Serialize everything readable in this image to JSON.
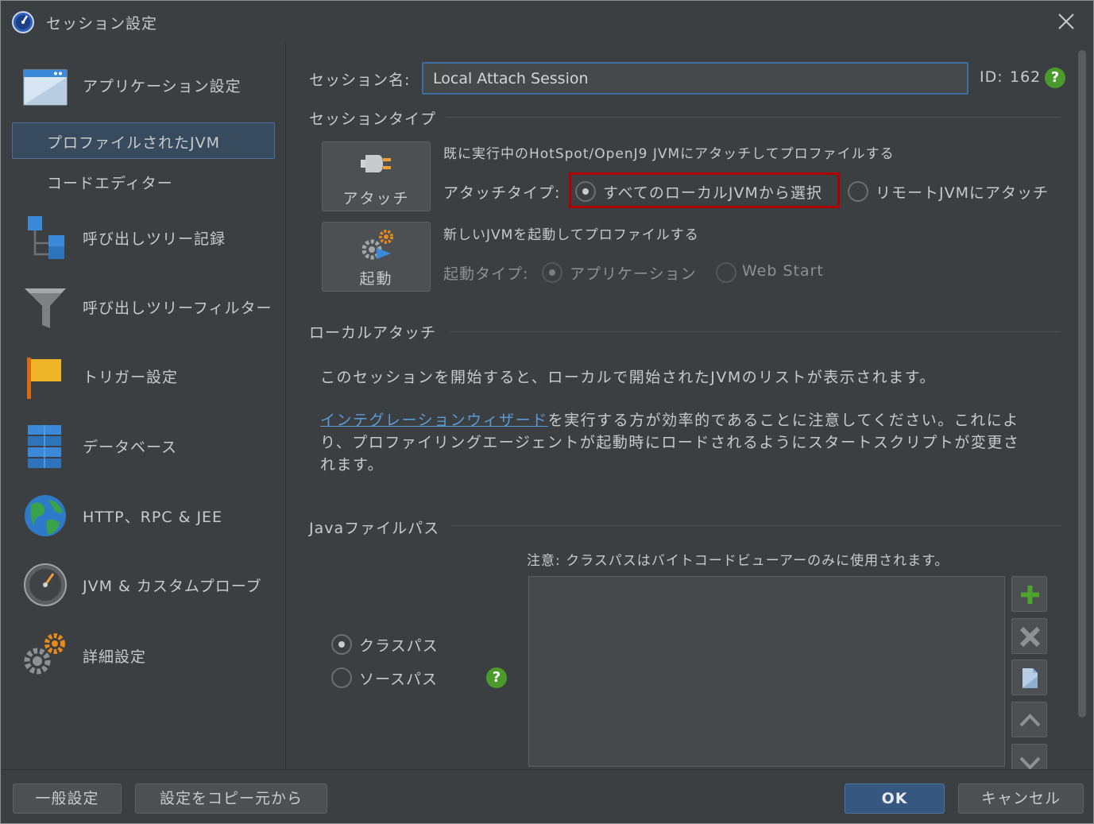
{
  "window": {
    "title": "セッション設定"
  },
  "sidebar": {
    "items": [
      {
        "label": "アプリケーション設定",
        "icon": "application-window-icon"
      },
      {
        "label": "プロファイルされたJVM",
        "selected": true
      },
      {
        "label": "コードエディター"
      },
      {
        "label": "呼び出しツリー記録",
        "icon": "call-tree-icon"
      },
      {
        "label": "呼び出しツリーフィルター",
        "icon": "funnel-icon"
      },
      {
        "label": "トリガー設定",
        "icon": "flag-icon"
      },
      {
        "label": "データベース",
        "icon": "database-icon"
      },
      {
        "label": "HTTP、RPC & JEE",
        "icon": "globe-icon"
      },
      {
        "label": "JVM & カスタムプローブ",
        "icon": "gauge-icon"
      },
      {
        "label": "詳細設定",
        "icon": "gears-icon"
      }
    ]
  },
  "main": {
    "session_name_label": "セッション名:",
    "session_name_value": "Local Attach Session",
    "id_label": "ID:",
    "id_value": "162",
    "session_type_title": "セッションタイプ",
    "attach_button": "アタッチ",
    "attach_desc": "既に実行中のHotSpot/OpenJ9 JVMにアタッチしてプロファイルする",
    "attach_type_label": "アタッチタイプ:",
    "attach_option_local": "すべてのローカルJVMから選択",
    "attach_option_remote": "リモートJVMにアタッチ",
    "launch_button": "起動",
    "launch_desc": "新しいJVMを起動してプロファイルする",
    "launch_type_label": "起動タイプ:",
    "launch_option_app": "アプリケーション",
    "launch_option_webstart": "Web Start",
    "local_attach_title": "ローカルアタッチ",
    "local_attach_para": "このセッションを開始すると、ローカルで開始されたJVMのリストが表示されます。",
    "wizard_link": "インテグレーションウィザード",
    "wizard_para_rest_1": "を実行する方が効率的であることに注意してください。これによ",
    "wizard_para_line_2": "り、プロファイリングエージェントが起動時にロードされるようにスタートスクリプトが変更さ",
    "wizard_para_line_3": "れます。",
    "java_path_title": "Javaファイルパス",
    "classpath_note": "注意: クラスパスはバイトコードビューアーのみに使用されます。",
    "radio_classpath": "クラスパス",
    "radio_sourcepath": "ソースパス"
  },
  "footer": {
    "general_settings": "一般設定",
    "copy_settings": "設定をコピー元から",
    "ok": "OK",
    "cancel": "キャンセル"
  },
  "colors": {
    "accent": "#365880",
    "highlight": "#b00000",
    "help": "#4a9a2c"
  }
}
